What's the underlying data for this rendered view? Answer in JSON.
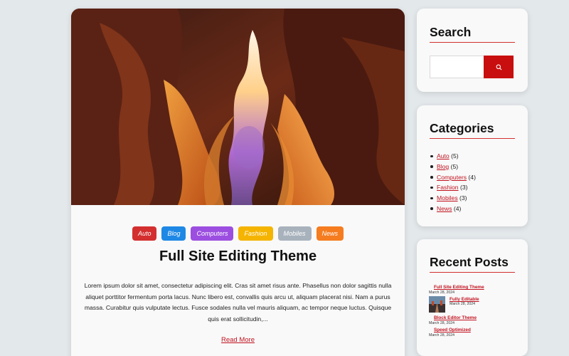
{
  "post": {
    "categories": [
      {
        "label": "Auto",
        "color": "#d32f2f"
      },
      {
        "label": "Blog",
        "color": "#1e88e5"
      },
      {
        "label": "Computers",
        "color": "#9c4ee0"
      },
      {
        "label": "Fashion",
        "color": "#f5b400"
      },
      {
        "label": "Mobiles",
        "color": "#a8b2bd"
      },
      {
        "label": "News",
        "color": "#f57c1f"
      }
    ],
    "title": "Full Site Editing Theme",
    "excerpt": "Lorem ipsum dolor sit amet, consectetur adipiscing elit. Cras sit amet risus ante. Phasellus non dolor sagittis nulla aliquet porttitor fermentum porta lacus. Nunc libero est, convallis quis arcu ut, aliquam placerat nisi. Nam a purus massa. Curabitur quis vulputate lectus. Fusce sodales nulla vel mauris aliquam, ac tempor neque luctus. Quisque quis erat sollicitudin,...",
    "read_more": "Read More"
  },
  "sidebar": {
    "search": {
      "title": "Search",
      "placeholder": "",
      "button_icon": "search-icon"
    },
    "categories": {
      "title": "Categories",
      "items": [
        {
          "name": "Auto",
          "count": "(5)"
        },
        {
          "name": "Blog",
          "count": "(5)"
        },
        {
          "name": "Computers",
          "count": "(4)"
        },
        {
          "name": "Fashion",
          "count": "(3)"
        },
        {
          "name": "Mobiles",
          "count": "(3)"
        },
        {
          "name": "News",
          "count": "(4)"
        }
      ]
    },
    "recent_posts": {
      "title": "Recent Posts",
      "items": [
        {
          "title": "Full Site Editing Theme",
          "date": "March 28, 2024"
        },
        {
          "title": "Fully Editable",
          "date": "March 28, 2024"
        },
        {
          "title": "Block Editor Theme",
          "date": "March 28, 2024"
        },
        {
          "title": "Speed Optimized",
          "date": "March 28, 2024"
        }
      ]
    }
  },
  "colors": {
    "accent": "#c80e0e",
    "link": "#c1121f",
    "background": "#e3e8eb",
    "card": "#f9f9f9"
  }
}
